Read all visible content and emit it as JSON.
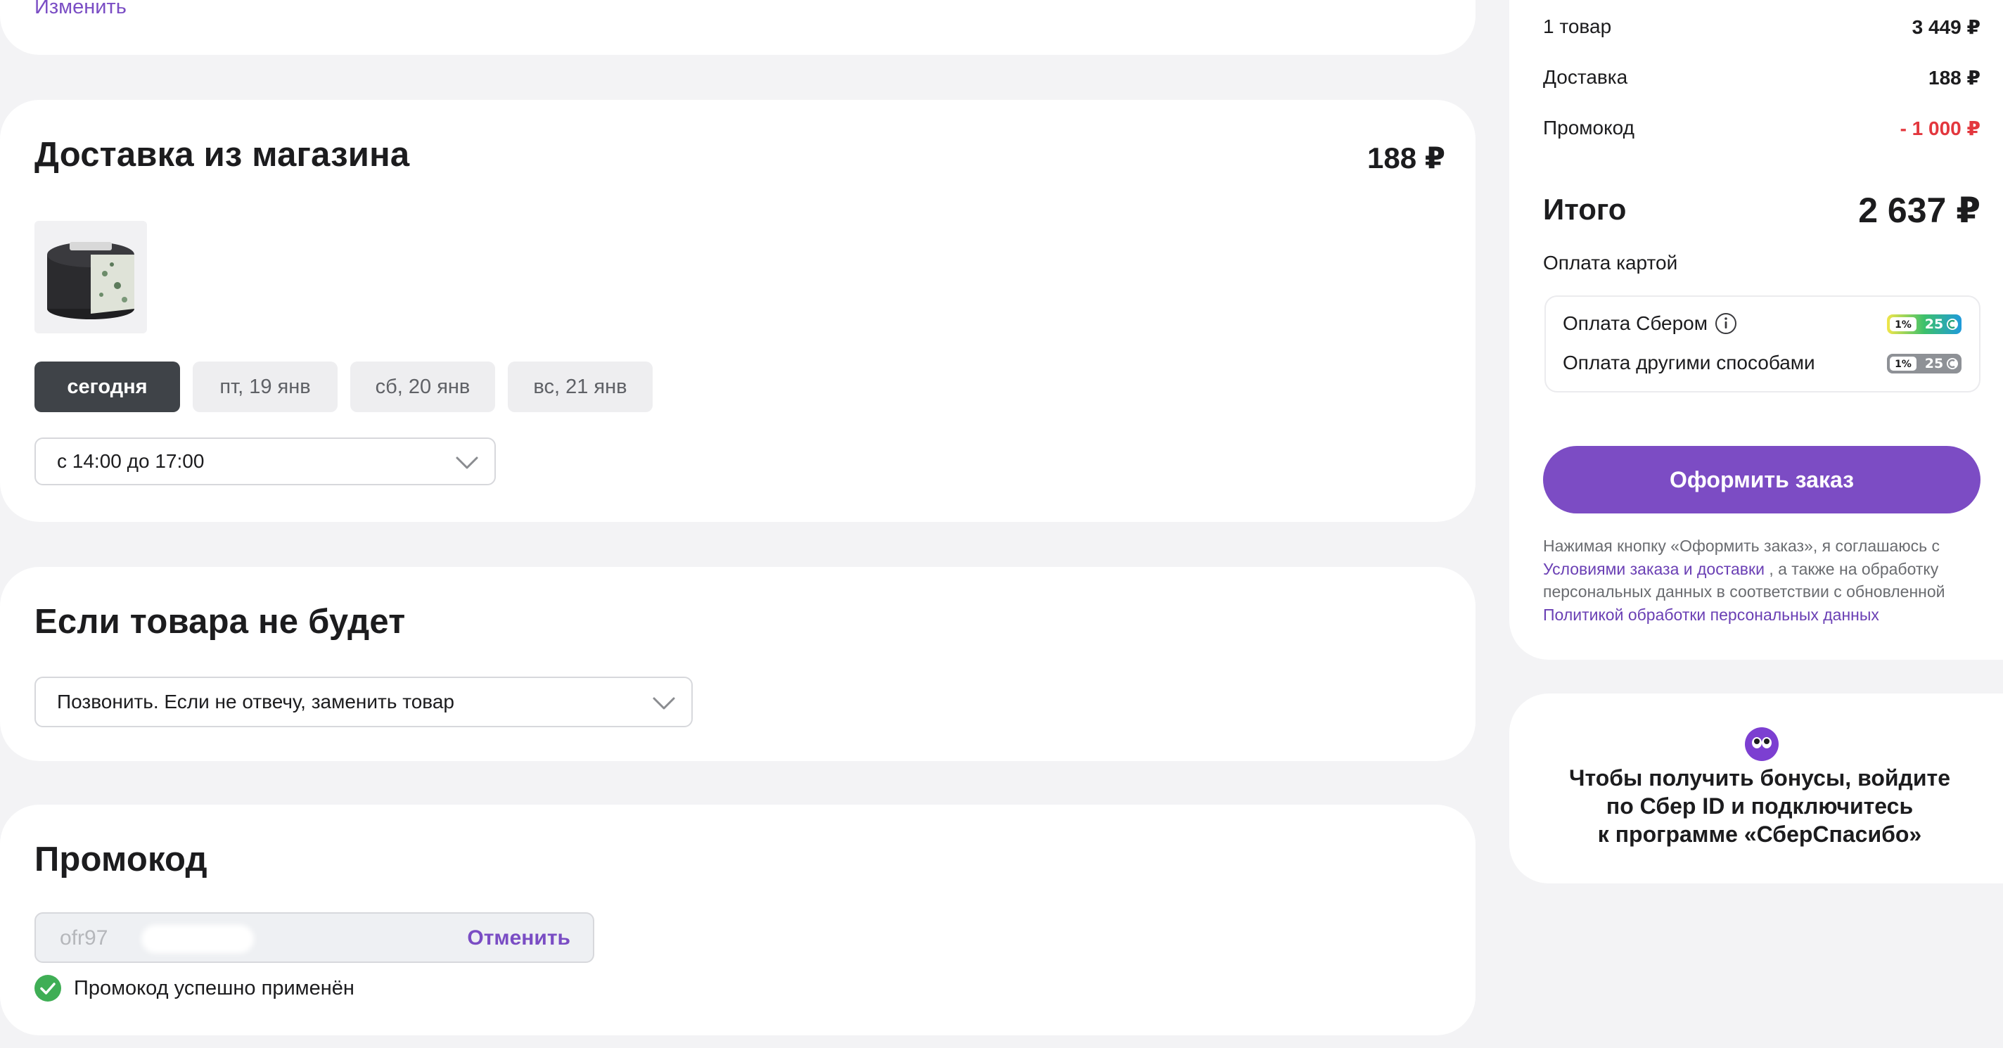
{
  "address_card": {
    "change_link": "Изменить"
  },
  "delivery": {
    "title": "Доставка из магазина",
    "price": "188 ₽",
    "dates": [
      "сегодня",
      "пт, 19 янв",
      "сб, 20 янв",
      "вс, 21 янв"
    ],
    "selected_date": "сегодня",
    "time_slot": "с 14:00 до 17:00"
  },
  "missing_item": {
    "title": "Если товара не будет",
    "option": "Позвонить. Если не отвечу, заменить товар"
  },
  "promo": {
    "title": "Промокод",
    "code": "ofr97",
    "cancel": "Отменить",
    "success": "Промокод успешно применён"
  },
  "summary": {
    "items_label": "1 товар",
    "items_value": "3 449 ₽",
    "delivery_label": "Доставка",
    "delivery_value": "188 ₽",
    "promo_label": "Промокод",
    "promo_value": "- 1 000 ₽",
    "total_label": "Итого",
    "total_value": "2 637 ₽",
    "payment_label": "Оплата картой",
    "pay_sber": "Оплата Сбером",
    "pay_other": "Оплата другими способами",
    "badge_percent": "1%",
    "badge_points": "25",
    "order_button": "Оформить заказ",
    "legal_intro": "Нажимая кнопку «Оформить заказ», я соглашаюсь с",
    "legal_link1": "Условиями заказа и доставки",
    "legal_mid": ", а также на обработку персональных данных в соответствии с обновленной",
    "legal_link2": "Политикой обработки персональных данных"
  },
  "bonus": {
    "line1": "Чтобы получить бонусы, войдите",
    "line2": "по Сбер ID и подключитесь",
    "line3": "к программе «СберСпасибо»"
  },
  "colors": {
    "accent": "#7c4cc4",
    "discount": "#e3373e",
    "success": "#3fae55",
    "chip_active": "#3f4348"
  }
}
